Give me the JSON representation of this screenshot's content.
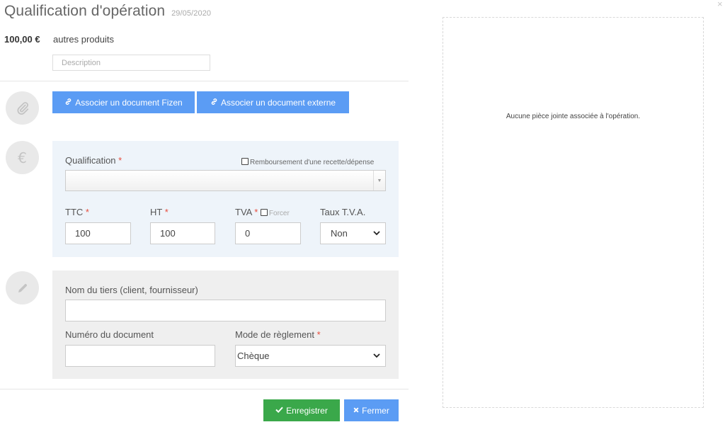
{
  "header": {
    "title": "Qualification d'opération",
    "date": "29/05/2020",
    "close_glyph": "×"
  },
  "operation": {
    "amount": "100,00 €",
    "category": "autres produits",
    "description_placeholder": "Description"
  },
  "documents": {
    "section_icon": "paperclip-icon",
    "link_fizen_label": "Associer un document Fizen",
    "link_external_label": "Associer un document externe",
    "link_icon": "link-icon"
  },
  "qualification": {
    "section_icon": "euro-icon",
    "label": "Qualification",
    "required_mark": "*",
    "refund_label": "Remboursement d'une recette/dépense",
    "refund_checked": false,
    "selected_value": "",
    "ttc_label": "TTC",
    "ttc_value": "100",
    "ht_label": "HT",
    "ht_value": "100",
    "tva_label": "TVA",
    "force_label": "Forcer",
    "force_checked": false,
    "tva_value": "0",
    "tva_rate_label": "Taux T.V.A.",
    "tva_rate_value": "Non"
  },
  "third_party": {
    "section_icon": "pencil-icon",
    "name_label": "Nom du tiers (client, fournisseur)",
    "name_value": "",
    "doc_number_label": "Numéro du document",
    "doc_number_value": "",
    "payment_label": "Mode de règlement",
    "payment_value": "Chèque"
  },
  "footer": {
    "save_label": "Enregistrer",
    "save_icon": "check-icon",
    "close_label": "Fermer",
    "close_icon": "x-icon"
  },
  "attachments": {
    "empty_text": "Aucune pièce jointe associée à l'opération."
  },
  "colors": {
    "primary": "#5b9cf4",
    "success": "#3aa84a",
    "required": "#e74c3c",
    "panel_blue": "#eef4fa",
    "panel_gray": "#efefef"
  }
}
